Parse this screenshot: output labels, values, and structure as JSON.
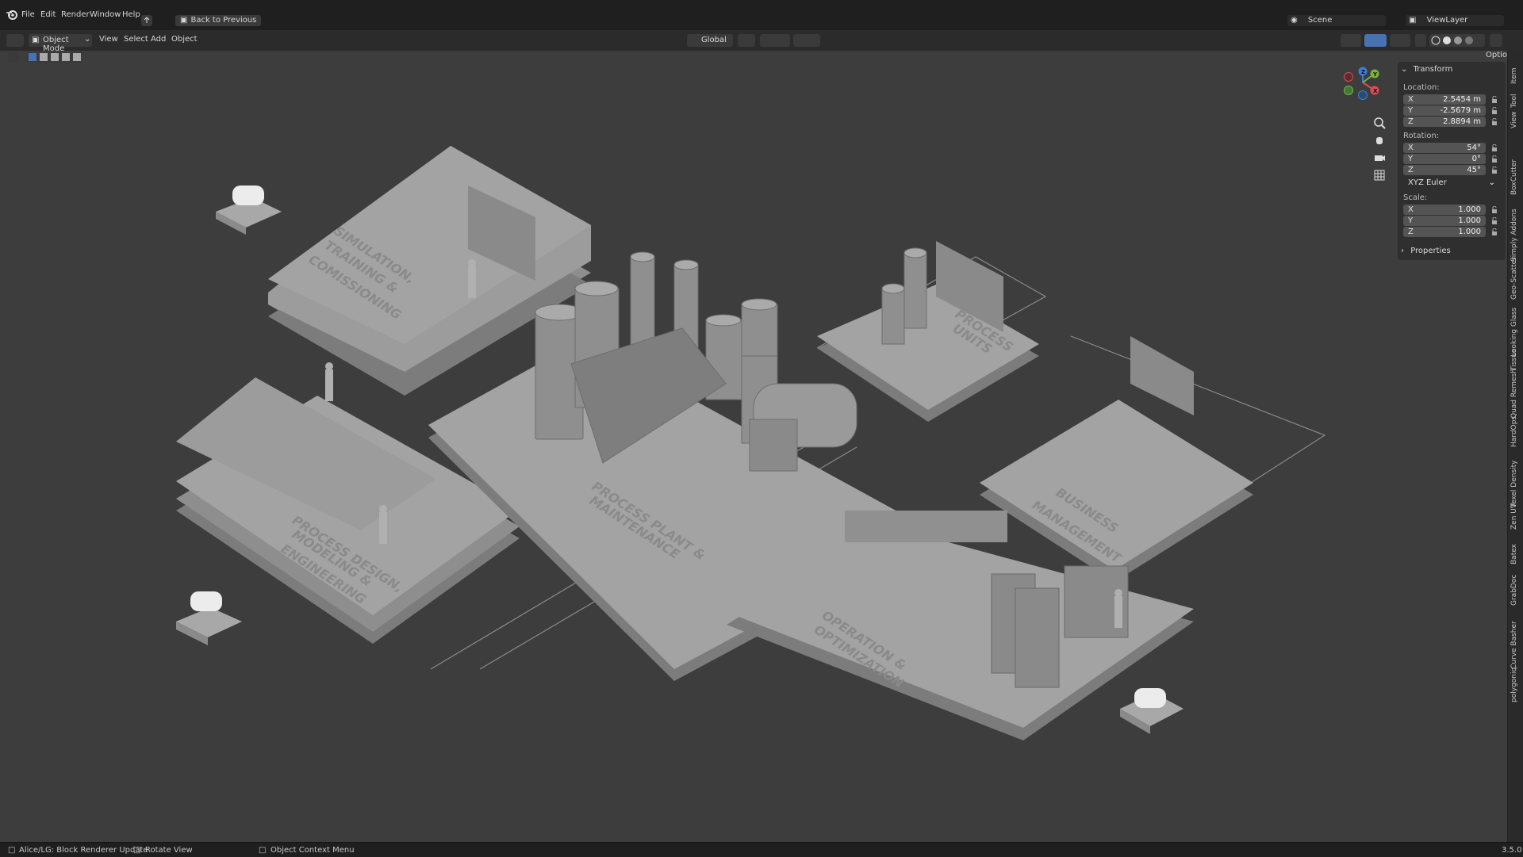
{
  "menu": {
    "file": "File",
    "edit": "Edit",
    "render": "Render",
    "window": "Window",
    "help": "Help",
    "back_button": "Back to Previous",
    "scene_label": "Scene",
    "view_layer_label": "ViewLayer"
  },
  "header": {
    "mode": "Object Mode",
    "view": "View",
    "select": "Select",
    "add": "Add",
    "object": "Object",
    "orientation": "Global",
    "options": "Options"
  },
  "npanel": {
    "transform_title": "Transform",
    "location_label": "Location:",
    "location": [
      {
        "axis": "X",
        "value": "2.5454 m"
      },
      {
        "axis": "Y",
        "value": "-2.5679 m"
      },
      {
        "axis": "Z",
        "value": "2.8894 m"
      }
    ],
    "rotation_label": "Rotation:",
    "rotation": [
      {
        "axis": "X",
        "value": "54°"
      },
      {
        "axis": "Y",
        "value": "0°"
      },
      {
        "axis": "Z",
        "value": "45°"
      }
    ],
    "rotation_mode": "XYZ Euler",
    "scale_label": "Scale:",
    "scale": [
      {
        "axis": "X",
        "value": "1.000"
      },
      {
        "axis": "Y",
        "value": "1.000"
      },
      {
        "axis": "Z",
        "value": "1.000"
      }
    ],
    "properties_title": "Properties"
  },
  "sidebar_tabs": [
    "Item",
    "Tool",
    "View",
    "BoxCutter",
    "Simply Addons",
    "Geo-Scatter",
    "Looking Glass",
    "Tissue",
    "Quad Remesh",
    "HardOps",
    "Texel Density",
    "Zen UV",
    "Batex",
    "GrabDoc",
    "Curve Basher",
    "polygoniq"
  ],
  "scene_labels": {
    "simulation": [
      "SIMULATION,",
      "TRAINING &",
      "COMISSIONING"
    ],
    "process_units": [
      "PROCESS",
      "UNITS"
    ],
    "process_plant": [
      "PROCESS PLANT &",
      "MAINTENANCE"
    ],
    "business": [
      "BUSINESS",
      "MANAGEMENT"
    ],
    "design": [
      "PROCESS DESIGN,",
      "MODELING &",
      "ENGINEERING"
    ],
    "operation": [
      "OPERATION &",
      "OPTIMIZATION"
    ]
  },
  "gizmo": {
    "x": "X",
    "y": "Y",
    "z": "Z"
  },
  "status": {
    "left": "Alice/LG: Block Renderer Update",
    "rotate": "Rotate View",
    "context": "Object Context Menu",
    "version": "3.5.0"
  },
  "colors": {
    "background": "#3d3d3d",
    "platform": "#9a9a9a",
    "platform_dark": "#7a7a7a",
    "axis_x": "#e04a55",
    "axis_y": "#7ab33b",
    "axis_z": "#3d7fd6"
  }
}
